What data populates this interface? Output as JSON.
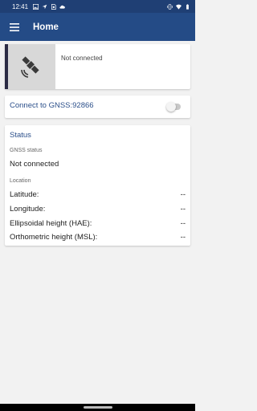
{
  "status_bar": {
    "time": "12:41",
    "icons_left": [
      "image-icon",
      "navigation-icon",
      "sim-icon",
      "cloud-icon"
    ],
    "icons_right": [
      "vibrate-icon",
      "wifi-icon",
      "battery-icon"
    ]
  },
  "app_bar": {
    "title": "Home",
    "menu_icon": "menu-icon",
    "background": "#244b86"
  },
  "connection_card": {
    "status_text": "Not connected",
    "thumbnail_icon": "satellite-icon"
  },
  "gnss_card": {
    "label": "Connect to GNSS:92866",
    "toggle_on": false
  },
  "status_card": {
    "title": "Status",
    "gnss_status_label": "GNSS status",
    "gnss_status_value": "Not connected",
    "location_label": "Location",
    "rows": [
      {
        "label": "Latitude:",
        "value": "--"
      },
      {
        "label": "Longitude:",
        "value": "--"
      },
      {
        "label": "Ellipsoidal height (HAE):",
        "value": "--"
      },
      {
        "label": "Orthometric height (MSL):",
        "value": "--"
      }
    ]
  },
  "colors": {
    "status_bar": "#1f3f74",
    "accent_text": "#2b4f8a",
    "page_background": "#f2f2f2"
  }
}
